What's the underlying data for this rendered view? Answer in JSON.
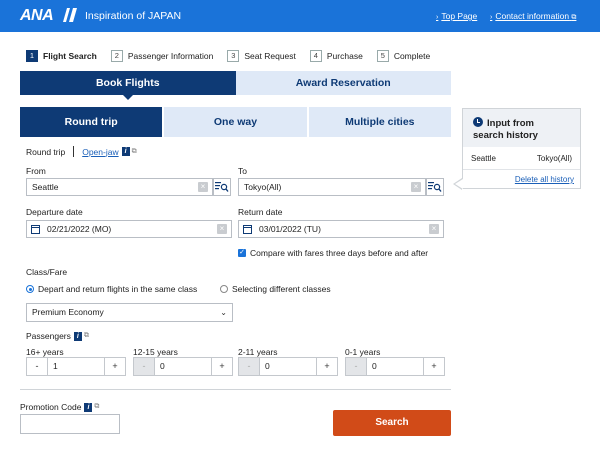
{
  "header": {
    "logo": "ANA",
    "title": "Inspiration of JAPAN",
    "top_page": "Top Page",
    "contact": "Contact information"
  },
  "steps": [
    {
      "num": "1",
      "label": "Flight Search"
    },
    {
      "num": "2",
      "label": "Passenger Information"
    },
    {
      "num": "3",
      "label": "Seat Request"
    },
    {
      "num": "4",
      "label": "Purchase"
    },
    {
      "num": "5",
      "label": "Complete"
    }
  ],
  "top_tabs": {
    "book": "Book Flights",
    "award": "Award Reservation"
  },
  "trip_tabs": {
    "round": "Round trip",
    "oneway": "One way",
    "multi": "Multiple cities"
  },
  "trip_row": {
    "current": "Round trip",
    "openjaw": "Open-jaw"
  },
  "from": {
    "label": "From",
    "value": "Seattle"
  },
  "to": {
    "label": "To",
    "value": "Tokyo(All)"
  },
  "departure": {
    "label": "Departure date",
    "value": "02/21/2022 (MO)"
  },
  "return": {
    "label": "Return date",
    "value": "03/01/2022 (TU)"
  },
  "compare": "Compare with fares three days before and after",
  "class_fare": {
    "label": "Class/Fare",
    "same": "Depart and return flights in the same class",
    "different": "Selecting different classes",
    "selected": "Premium Economy"
  },
  "passengers": {
    "label": "Passengers",
    "groups": [
      {
        "label": "16+ years",
        "value": "1"
      },
      {
        "label": "12-15 years",
        "value": "0"
      },
      {
        "label": "2-11 years",
        "value": "0"
      },
      {
        "label": "0-1 years",
        "value": "0"
      }
    ]
  },
  "promo": {
    "label": "Promotion Code",
    "value": ""
  },
  "search_button": "Search",
  "history": {
    "title_line1": "Input from",
    "title_line2": "search history",
    "from": "Seattle",
    "to": "Tokyo(All)",
    "delete_all": "Delete all history"
  },
  "colors": {
    "brand_blue": "#1a73d9",
    "navy": "#0e3a75",
    "search_orange": "#d14b18"
  }
}
